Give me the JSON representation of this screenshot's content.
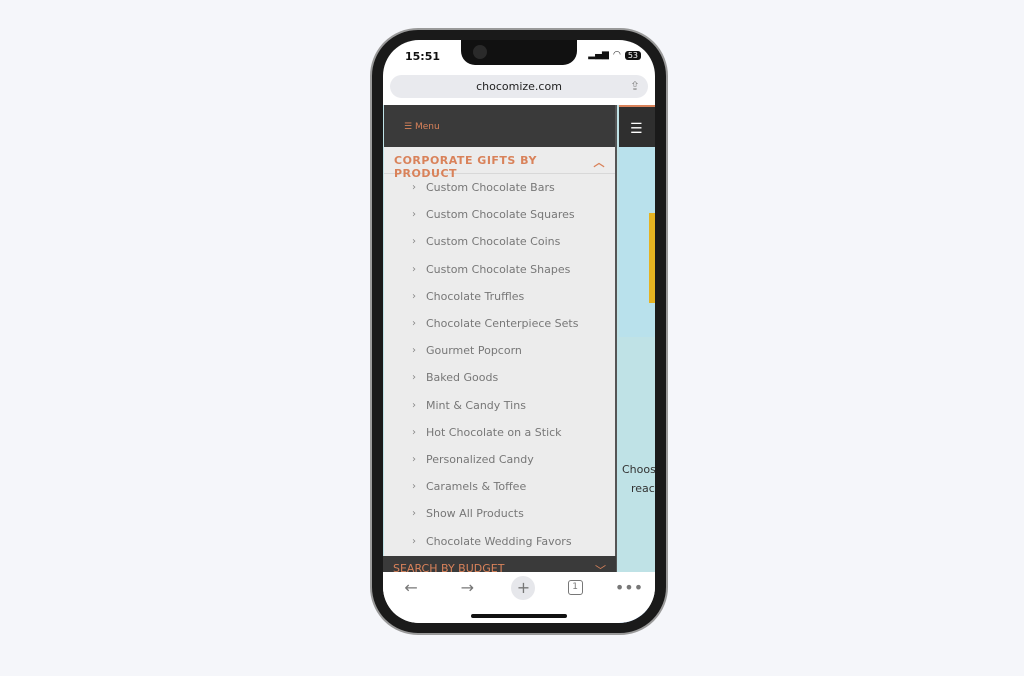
{
  "status": {
    "time": "15:51",
    "battery": "53"
  },
  "browser": {
    "url": "chocomize.com"
  },
  "menu": {
    "label": "Menu",
    "category": "CORPORATE GIFTS BY PRODUCT",
    "items": [
      "Custom Chocolate Bars",
      "Custom Chocolate Squares",
      "Custom Chocolate Coins",
      "Custom Chocolate Shapes",
      "Chocolate Truffles",
      "Chocolate Centerpiece Sets",
      "Gourmet Popcorn",
      "Baked Goods",
      "Mint & Candy Tins",
      "Hot Chocolate on a Stick",
      "Personalized Candy",
      "Caramels & Toffee",
      "Show All Products",
      "Chocolate Wedding Favors"
    ],
    "next_category": "SEARCH BY BUDGET"
  },
  "page": {
    "text1": "Choos",
    "text2": "reac"
  },
  "toolbar": {
    "tabs_count": "1"
  },
  "colors": {
    "accent": "#d9825a",
    "chat": "#1a6fd0"
  }
}
